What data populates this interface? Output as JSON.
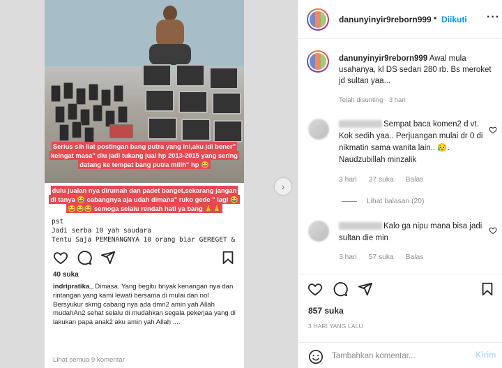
{
  "post_image": {
    "overlay_text_1": "Serius sih liat postingan bang putra yang ini,aku jdi bener\" keingat masa\" dlu jadi tukang jual hp 2013-2015 yang sering datang ke tempat bang putra milih\" hp 😂",
    "overlay_text_2": "dulu jualan nya dirumah dan padet banget,sekarang jangan di tanya 😂 cabangnya aja udah dimana\" ruko gede \" lagi 😂😂😂😂 semoga selalu rendah hati ya bang 🙏🙏",
    "under_text_prefix": "pst",
    "under_text_1": "Jadi serba 10 yah saudara",
    "under_text_2": "Tentu Saja PEMENANGNYA 10 orang biar GEREGET &",
    "likes": "40 suka",
    "caption_user": "indripratika_",
    "caption_text": "Dimasa. Yang begitu bnyak kenangan nya dan rintangan yang kami lewati bersama di mulai dari nol",
    "caption_text_2": "Bersyukur skrng cabang nya ada dmn2 amin yah Allah mudahAn2 sehat selalu di mudahkan segala pekerjaa yang di lakukan papa anak2 aku amin yah Allah ....",
    "view_all": "Lihat semua 9 komentar"
  },
  "header": {
    "username": "danunyinyir9reborn999",
    "dot": "•",
    "follow_label": "Diikuti",
    "more_label": "···"
  },
  "caption": {
    "username": "danunyinyir9reborn999",
    "text": "Awal mula usahanya, kl DS sedari 280 rb. Bs meroket jd sultan yaa...",
    "edited": "Telah disunting · 3 hari"
  },
  "comments": [
    {
      "text": "Sempat baca komen2 d vt. Kok sedih yaa.. Perjuangan mulai dr 0 di nikmatin sama wanita lain.. 😥. Naudzubillah minzalik",
      "time": "3 hari",
      "likes": "37 suka",
      "reply": "Balas"
    },
    {
      "text": "Kalo ga nipu mana bisa jadi sultan die min",
      "time": "3 hari",
      "likes": "57 suka",
      "reply": "Balas"
    }
  ],
  "replies_label": "Lihat balasan (20)",
  "footer": {
    "likes": "857 suka",
    "date": "3 HARI YANG LALU",
    "comment_placeholder": "Tambahkan komentar...",
    "post_label": "Kirim"
  },
  "icons": {
    "like": "heart-icon",
    "comment": "comment-icon",
    "share": "share-icon",
    "save": "bookmark-icon",
    "emoji": "emoji-icon",
    "next": "chevron-right-icon"
  },
  "colors": {
    "accent": "#0095f6",
    "overlay_red": "#e8484f",
    "muted": "#8e8e8e"
  }
}
